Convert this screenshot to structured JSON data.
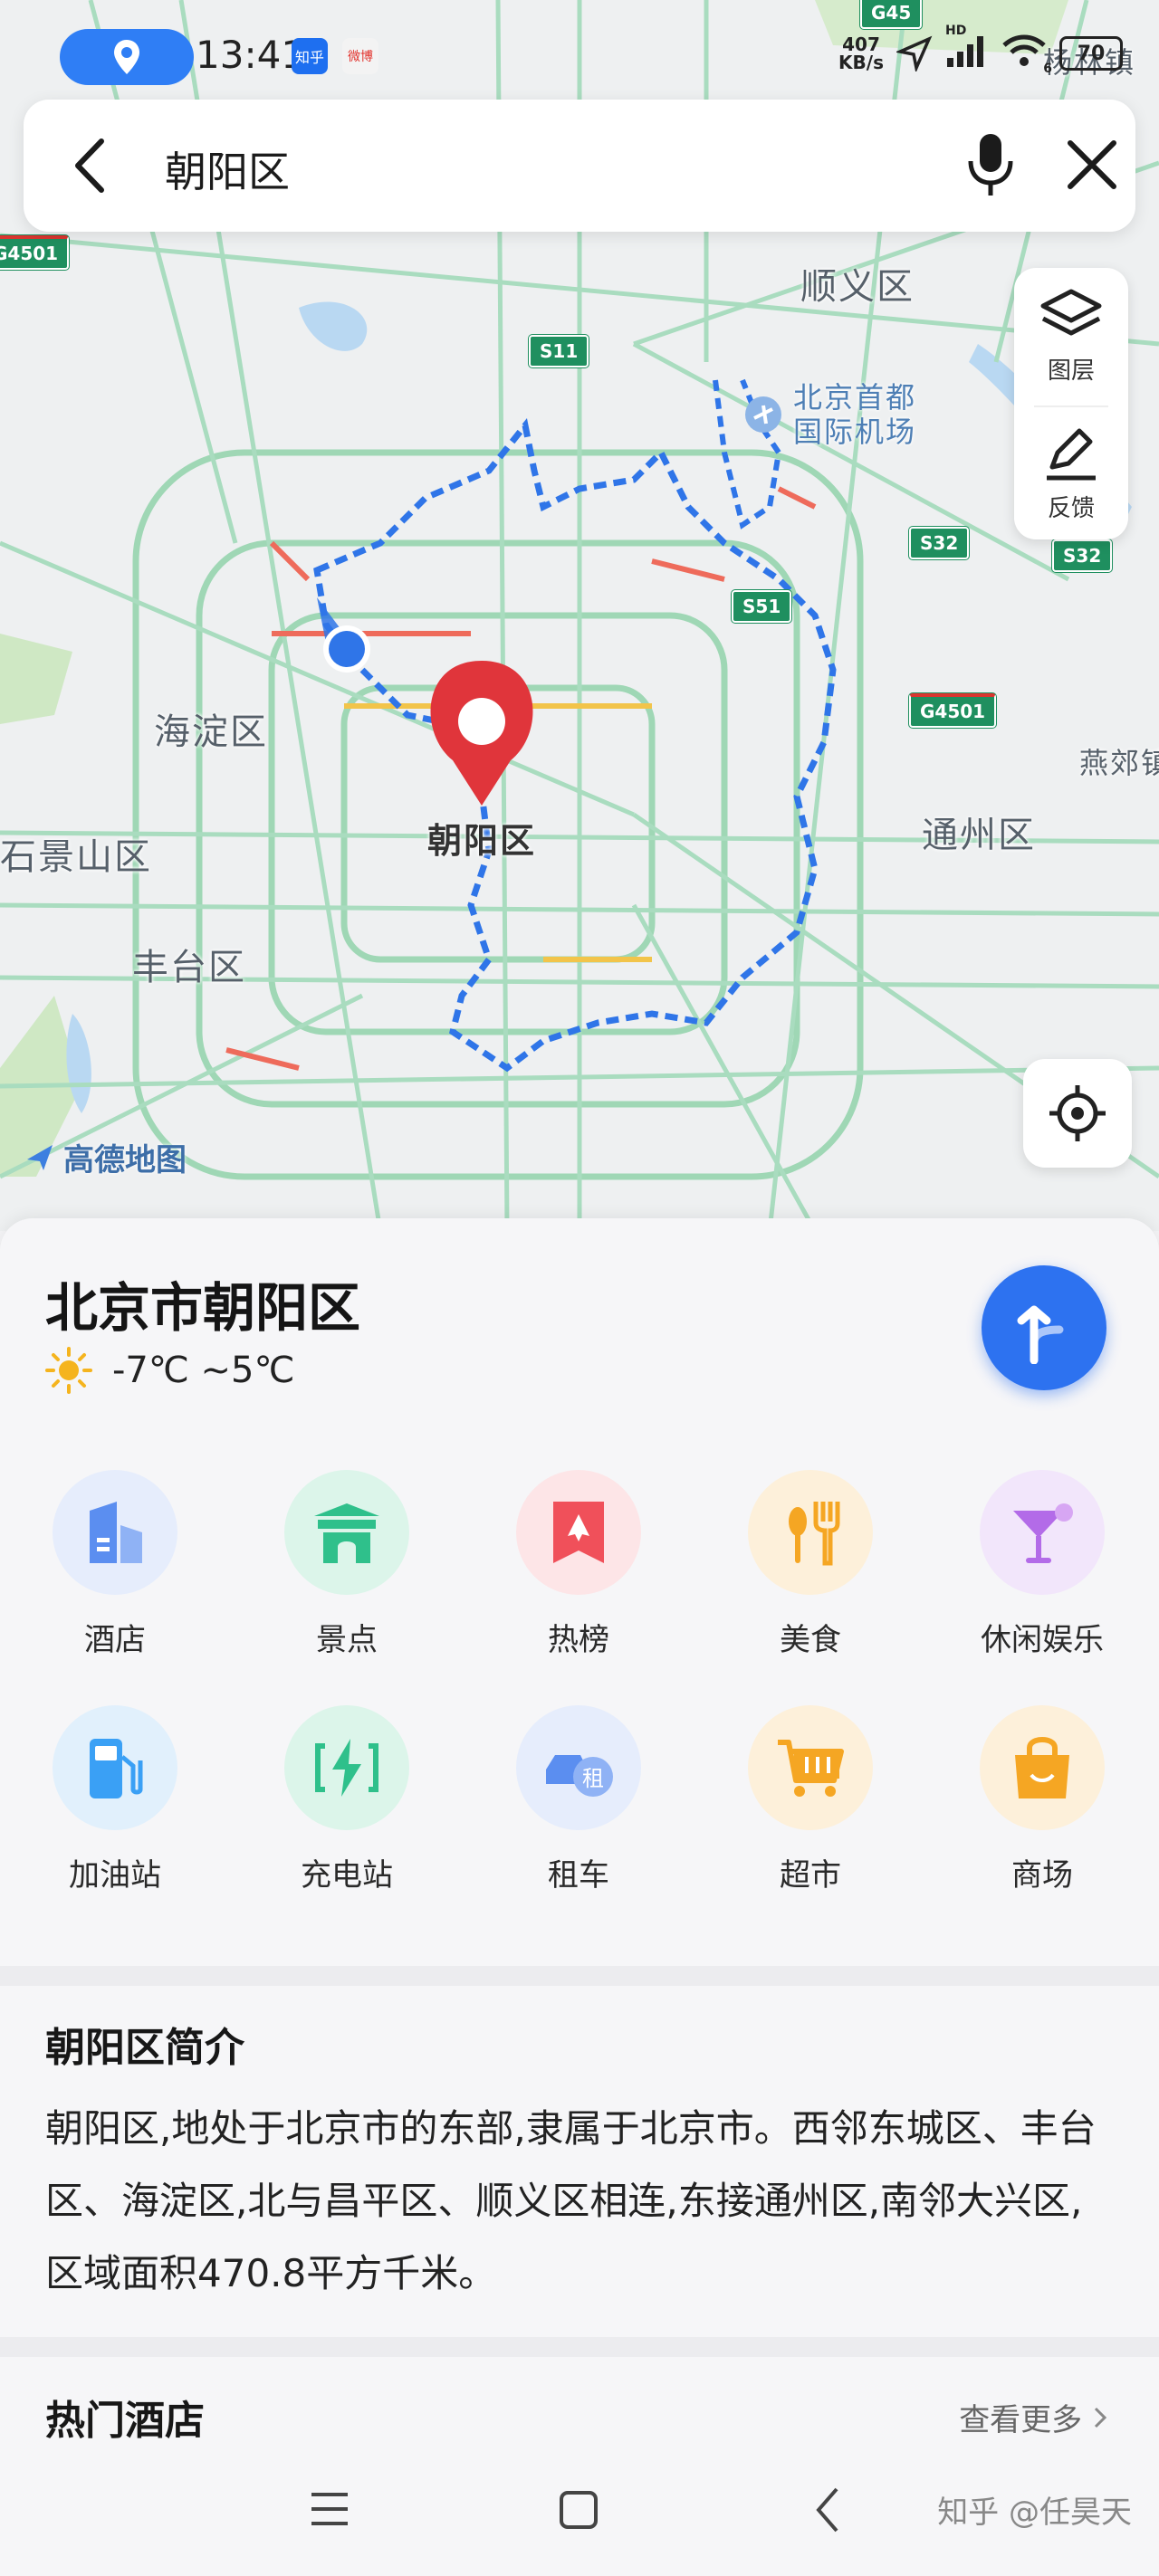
{
  "status_bar": {
    "time": "13:41",
    "apps": [
      "知乎",
      "微博"
    ],
    "net_speed_value": "407",
    "net_speed_unit": "KB/s",
    "signal_label": "HD",
    "wifi_label": "6",
    "battery": "70"
  },
  "search": {
    "query": "朝阳区"
  },
  "map": {
    "labels": {
      "shunyi": "顺义区",
      "airport": "北京首都\n国际机场",
      "haidian": "海淀区",
      "chaoyang": "朝阳区",
      "shijingshan": "石景山区",
      "fengtai": "丰台区",
      "tongzhou": "通州区",
      "yanjiao": "燕郊镇",
      "top_right": "杨林镇"
    },
    "road_shields": [
      "G45",
      "S11",
      "S32",
      "S51",
      "G4501",
      "G4501",
      "S32"
    ],
    "tools": {
      "layers": "图层",
      "feedback": "反馈"
    },
    "logo": "高德地图"
  },
  "place": {
    "title": "北京市朝阳区",
    "weather": "-7℃ ~5℃"
  },
  "categories": [
    {
      "label": "酒店",
      "icon": "hotel-icon",
      "color": "#5b8ef0"
    },
    {
      "label": "景点",
      "icon": "scenic-spot-icon",
      "color": "#2fc08b"
    },
    {
      "label": "热榜",
      "icon": "hot-list-icon",
      "color": "#f0505a"
    },
    {
      "label": "美食",
      "icon": "food-icon",
      "color": "#f5a623"
    },
    {
      "label": "休闲娱乐",
      "icon": "entertainment-icon",
      "color": "#b36be8"
    },
    {
      "label": "加油站",
      "icon": "gas-station-icon",
      "color": "#3aa0f5"
    },
    {
      "label": "充电站",
      "icon": "charging-station-icon",
      "color": "#2fc08b"
    },
    {
      "label": "租车",
      "icon": "car-rental-icon",
      "color": "#5b8ef0"
    },
    {
      "label": "超市",
      "icon": "supermarket-icon",
      "color": "#f5a623"
    },
    {
      "label": "商场",
      "icon": "mall-icon",
      "color": "#f5a623"
    }
  ],
  "intro": {
    "title": "朝阳区简介",
    "text": "朝阳区,地处于北京市的东部,隶属于北京市。西邻东城区、丰台区、海淀区,北与昌平区、顺义区相连,东接通州区,南邻大兴区,区域面积470.8平方千米。"
  },
  "hotels": {
    "title": "热门酒店",
    "more": "查看更多"
  },
  "watermark": "知乎 @任昊天"
}
